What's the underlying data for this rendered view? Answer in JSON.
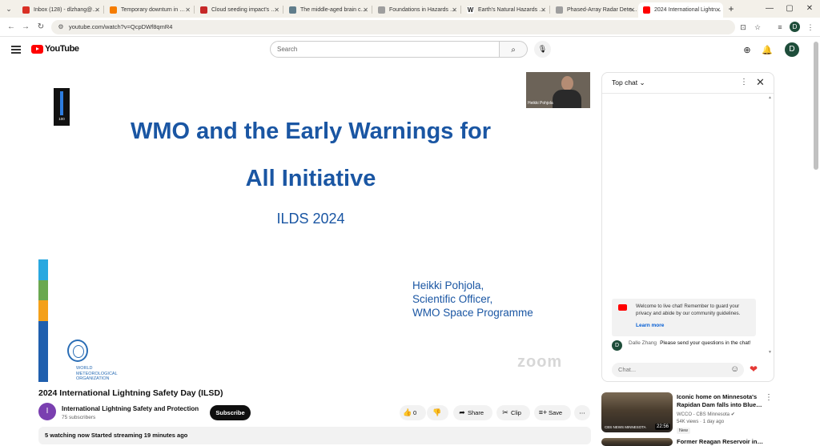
{
  "browser": {
    "tabs": [
      {
        "title": "Inbox (128) - dlzhang@…",
        "fav_color": "#d93025"
      },
      {
        "title": "Temporary downturn in …",
        "fav_color": "#f57c00"
      },
      {
        "title": "Cloud seeding impact's …",
        "fav_color": "#c62828"
      },
      {
        "title": "The middle-aged brain c…",
        "fav_color": "#607d8b"
      },
      {
        "title": "Foundations in Hazards …",
        "fav_color": "#9e9e9e"
      },
      {
        "title": "Earth's Natural Hazards …",
        "fav_color": "#333333"
      },
      {
        "title": "Phased-Array Radar Dete…",
        "fav_color": "#9e9e9e"
      },
      {
        "title": "2024 International Lightn…",
        "fav_color": "#ff0000"
      }
    ],
    "new_tab": "+",
    "url": "youtube.com/watch?v=QcpDWf8qmR4",
    "profile_initial": "D"
  },
  "youtube": {
    "logo_text": "YouTube",
    "search_placeholder": "Search",
    "avatar_initial": "D"
  },
  "video": {
    "slide_title_line1": "WMO and the Early Warnings for",
    "slide_title_line2": "All Initiative",
    "slide_subtitle": "ILDS 2024",
    "speaker_name": "Heikki Pohjola,",
    "speaker_role": "Scientific Officer,",
    "speaker_program": "WMO Space Programme",
    "thermo_value": "100",
    "org_name_line1": "WORLD",
    "org_name_line2": "METEOROLOGICAL",
    "org_name_line3": "ORGANIZATION",
    "watermark": "zoom",
    "cam_label": "Heikki Pohjola",
    "strip_colors": [
      "#29a8e0",
      "#6aa84f",
      "#f4a019",
      "#1f5fae"
    ]
  },
  "video_info": {
    "title": "2024 International Lightning Safety Day (ILSD)",
    "channel_initial": "I",
    "channel_name": "International Lightning Safety and Protection",
    "subscribers": "75 subscribers",
    "subscribe_label": "Subscribe",
    "like_count": "0",
    "share_label": "Share",
    "clip_label": "Clip",
    "save_label": "Save",
    "description": "5 watching now  Started streaming 19 minutes ago"
  },
  "chat": {
    "header": "Top chat",
    "welcome": "Welcome to live chat! Remember to guard your privacy and abide by our community guidelines.",
    "learn_more": "Learn more",
    "message_author_initial": "D",
    "message_author": "Dalle Zhang",
    "message_text": "Please send your questions in the chat!",
    "input_placeholder": "Chat..."
  },
  "recommendations": [
    {
      "title": "Iconic home on Minnesota's Rapidan Dam falls into Blue…",
      "channel": "WCCO - CBS Minnesota",
      "views": "54K views",
      "age": "1 day ago",
      "badge": "New",
      "duration": "22:56",
      "logo": "CBS NEWS MINNESOTA"
    },
    {
      "title": "Former Reagan Reservoir in…"
    }
  ]
}
